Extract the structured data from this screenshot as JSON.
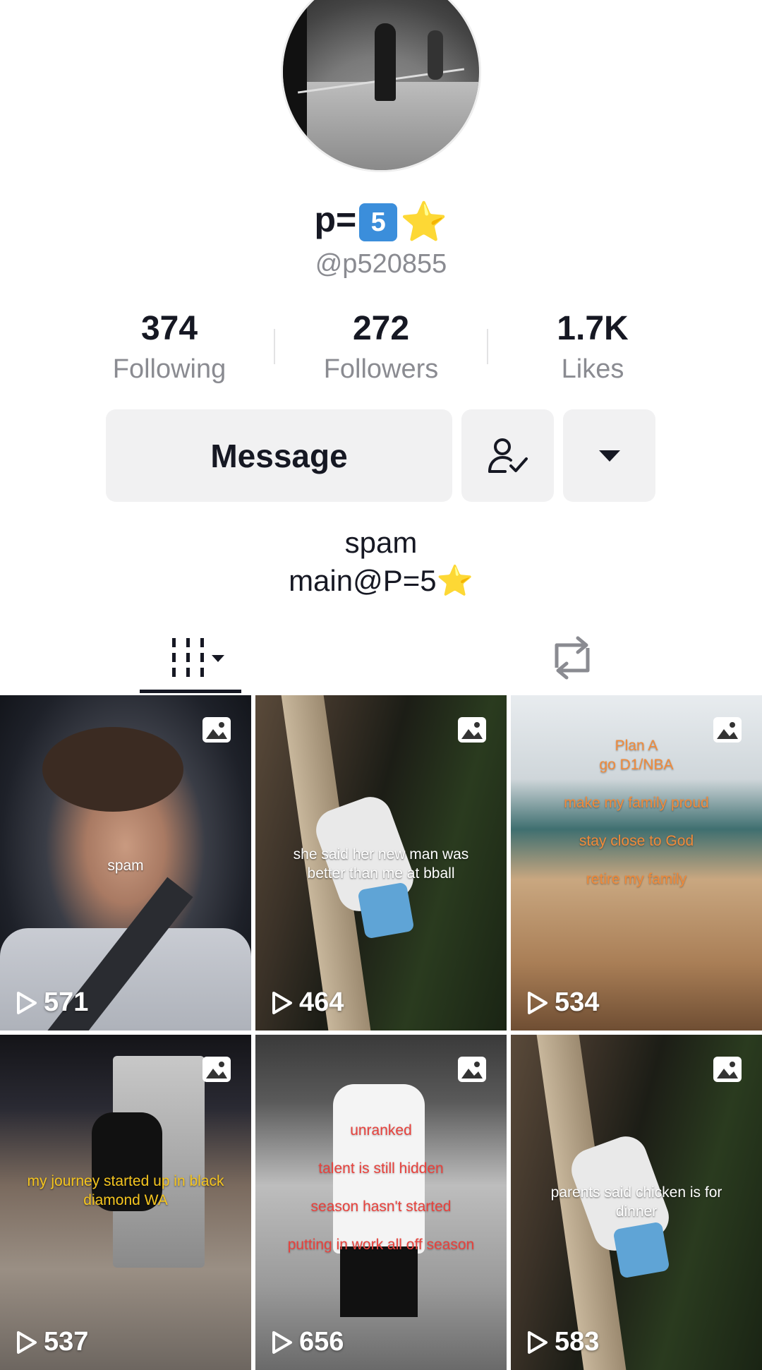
{
  "profile": {
    "display_name_text": "p=",
    "display_name_emoji_number": "5",
    "display_name_star": "⭐",
    "handle": "@p520855"
  },
  "stats": {
    "following": {
      "value": "374",
      "label": "Following"
    },
    "followers": {
      "value": "272",
      "label": "Followers"
    },
    "likes": {
      "value": "1.7K",
      "label": "Likes"
    }
  },
  "actions": {
    "message_label": "Message",
    "follow_state_icon": "person-check-icon",
    "more_icon": "caret-down-icon"
  },
  "bio": {
    "line1": "spam",
    "line2_text": "main@P=5",
    "line2_star": "⭐"
  },
  "tabs": {
    "videos_icon": "grid-bars-icon",
    "reposts_icon": "repost-icon"
  },
  "colors": {
    "text_primary": "#161823",
    "text_secondary": "#8a8b91",
    "button_bg": "#f1f1f2"
  },
  "grid": [
    {
      "views": "571",
      "caption_lines": [
        "spam"
      ],
      "caption_color": "white",
      "type": "photo"
    },
    {
      "views": "464",
      "caption_lines": [
        "she said her new man was",
        "better than me at bball"
      ],
      "caption_color": "white",
      "type": "photo"
    },
    {
      "views": "534",
      "caption_lines": [
        "Plan A",
        "go D1/NBA",
        "",
        "make my family proud",
        "",
        "stay close to God",
        "",
        "retire my family"
      ],
      "caption_color": "orange",
      "type": "photo"
    },
    {
      "views": "537",
      "caption_lines": [
        "my journey started up in black",
        "diamond WA"
      ],
      "caption_color": "yellow",
      "type": "photo"
    },
    {
      "views": "656",
      "caption_lines": [
        "unranked",
        "",
        "talent is still hidden",
        "",
        "season hasn't started",
        "",
        "putting in work all off season"
      ],
      "caption_color": "red",
      "type": "photo"
    },
    {
      "views": "583",
      "caption_lines": [
        "parents said chicken is for",
        "dinner"
      ],
      "caption_color": "white",
      "type": "photo"
    }
  ]
}
